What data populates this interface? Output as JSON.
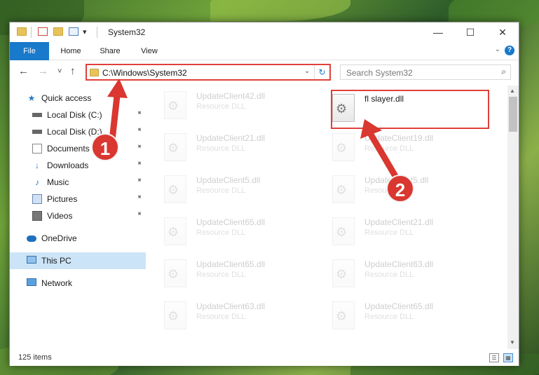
{
  "window": {
    "title": "System32",
    "min_glyph": "—",
    "max_glyph": "☐",
    "close_glyph": "✕",
    "qat_dropdown_glyph": "▾"
  },
  "ribbon": {
    "tabs": [
      "File",
      "Home",
      "Share",
      "View"
    ],
    "help_glyph": "?",
    "collapse_glyph": "⌄"
  },
  "nav": {
    "back_glyph": "←",
    "forward_glyph": "→",
    "recent_glyph": "˅",
    "up_glyph": "↑",
    "address_path": "C:\\Windows\\System32",
    "address_dropdown_glyph": "⌄",
    "refresh_glyph": "↻",
    "search_placeholder": "Search System32",
    "search_glyph": "⌕"
  },
  "sidebar": {
    "items": [
      {
        "label": "Quick access",
        "icon": "star-icon"
      },
      {
        "label": "Local Disk (C:)",
        "icon": "drive-icon",
        "pinned": true
      },
      {
        "label": "Local Disk (D:)",
        "icon": "drive-icon",
        "pinned": true
      },
      {
        "label": "Documents",
        "icon": "documents-icon",
        "pinned": true
      },
      {
        "label": "Downloads",
        "icon": "download-icon",
        "pinned": true
      },
      {
        "label": "Music",
        "icon": "music-icon",
        "pinned": true
      },
      {
        "label": "Pictures",
        "icon": "pictures-icon",
        "pinned": true
      },
      {
        "label": "Videos",
        "icon": "videos-icon",
        "pinned": true
      },
      {
        "label": "OneDrive",
        "icon": "cloud-icon"
      },
      {
        "label": "This PC",
        "icon": "computer-icon",
        "active": true
      },
      {
        "label": "Network",
        "icon": "network-icon"
      }
    ],
    "pin_glyph": "📌"
  },
  "files": {
    "left_column": [
      {
        "name": "UpdateClient42.dll",
        "type": "Resource DLL"
      },
      {
        "name": "UpdateClient21.dll",
        "type": "Resource DLL"
      },
      {
        "name": "UpdateClient5.dll",
        "type": "Resource DLL"
      },
      {
        "name": "UpdateClient65.dll",
        "type": "Resource DLL"
      },
      {
        "name": "UpdateClient65.dll",
        "type": "Resource DLL"
      },
      {
        "name": "UpdateClient63.dll",
        "type": "Resource DLL"
      }
    ],
    "right_column": [
      {
        "name": "fl slayer.dll",
        "type": "",
        "highlighted": true
      },
      {
        "name": "UpdateClient19.dll",
        "type": "Resource DLL"
      },
      {
        "name": "UpdateClient5.dll",
        "type": "Resource DLL"
      },
      {
        "name": "UpdateClient21.dll",
        "type": "Resource DLL"
      },
      {
        "name": "UpdateClient63.dll",
        "type": "Resource DLL"
      },
      {
        "name": "UpdateClient65.dll",
        "type": "Resource DLL"
      }
    ],
    "gear_glyph": "⚙"
  },
  "scrollbar": {
    "up_glyph": "▲",
    "down_glyph": "▼"
  },
  "status": {
    "item_count": "125 items",
    "details_view_glyph": "☰",
    "icons_view_glyph": "▦"
  },
  "annotations": {
    "step1": "1",
    "step2": "2",
    "color": "#d9372f"
  }
}
